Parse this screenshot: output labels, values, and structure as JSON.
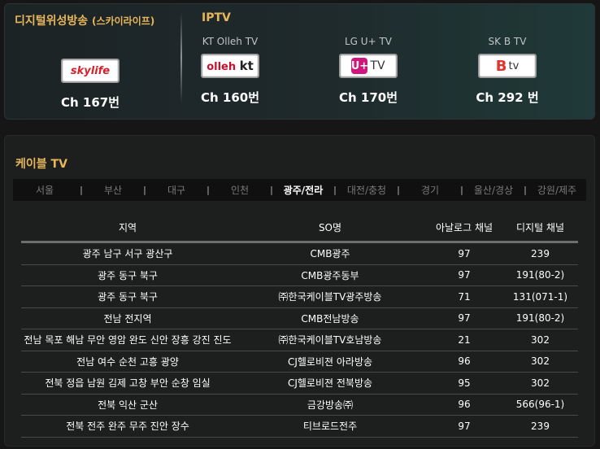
{
  "satellite": {
    "title": "디지털위성방송",
    "subtitle": "(스카이라이프)",
    "provider": {
      "logo": "skylife",
      "channel": "Ch 167번"
    }
  },
  "iptv": {
    "title": "IPTV",
    "providers": [
      {
        "name": "KT Olleh TV",
        "logo_text": "olleh",
        "logo_text2": "kt",
        "channel": "Ch 160번"
      },
      {
        "name": "LG U+ TV",
        "logo_text": "U+",
        "logo_text2": "TV",
        "channel": "Ch 170번"
      },
      {
        "name": "SK B TV",
        "logo_text": "B",
        "logo_text2": "tv",
        "channel": "Ch 292 번"
      }
    ]
  },
  "cable": {
    "title": "케이블 TV",
    "tabs": [
      "서울",
      "부산",
      "대구",
      "인천",
      "광주/전라",
      "대전/충청",
      "경기",
      "울산/경상",
      "강원/제주"
    ],
    "separator": "|",
    "active_tab": "광주/전라",
    "table": {
      "headers": [
        "지역",
        "SO명",
        "아날로그 채널",
        "디지털 채널"
      ],
      "rows": [
        [
          "광주 남구 서구 광산구",
          "CMB광주",
          "97",
          "239"
        ],
        [
          "광주 동구 북구",
          "CMB광주동부",
          "97",
          "191(80-2)"
        ],
        [
          "광주 동구 북구",
          "㈜한국케이블TV광주방송",
          "71",
          "131(071-1)"
        ],
        [
          "전남 전지역",
          "CMB전남방송",
          "97",
          "191(80-2)"
        ],
        [
          "전남 목포 해남 무안 영암 완도 신안 장흥 강진 진도",
          "㈜한국케이블TV호남방송",
          "21",
          "302"
        ],
        [
          "전남 여수 순천 고흥 광양",
          "CJ헬로비젼 아라방송",
          "96",
          "302"
        ],
        [
          "전북 정읍 남원 김제 고창 부안 순창 임실",
          "CJ헬로비젼 전북방송",
          "95",
          "302"
        ],
        [
          "전북 익산 군산",
          "금강방송㈜",
          "96",
          "566(96-1)"
        ],
        [
          "전북 전주 완주 무주 진안 장수",
          "티브로드전주",
          "97",
          "239"
        ]
      ]
    }
  }
}
